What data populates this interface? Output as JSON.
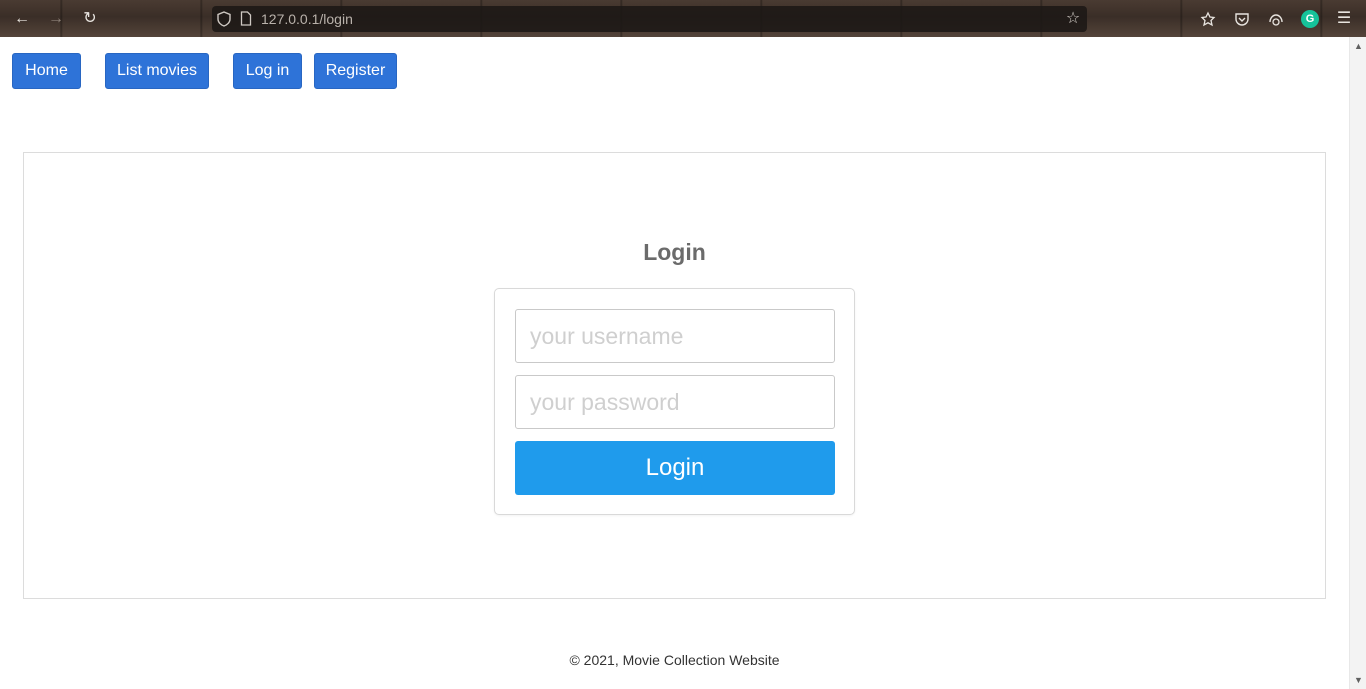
{
  "browser": {
    "url": "127.0.0.1/login",
    "icons": {
      "back": "back-arrow-icon",
      "forward": "forward-arrow-icon",
      "reload": "reload-icon",
      "shield": "shield-icon",
      "page": "page-icon",
      "bookmark": "star-icon",
      "grammarly_letter": "G"
    }
  },
  "nav": {
    "home": "Home",
    "list_movies": "List movies",
    "log_in": "Log in",
    "register": "Register"
  },
  "login": {
    "title": "Login",
    "username_placeholder": "your username",
    "password_placeholder": "your password",
    "submit_label": "Login"
  },
  "footer": {
    "text": "© 2021, Movie Collection Website"
  },
  "colors": {
    "nav_button": "#2e73d8",
    "submit_button": "#1f9bec",
    "title_text": "#6b6b6b"
  }
}
